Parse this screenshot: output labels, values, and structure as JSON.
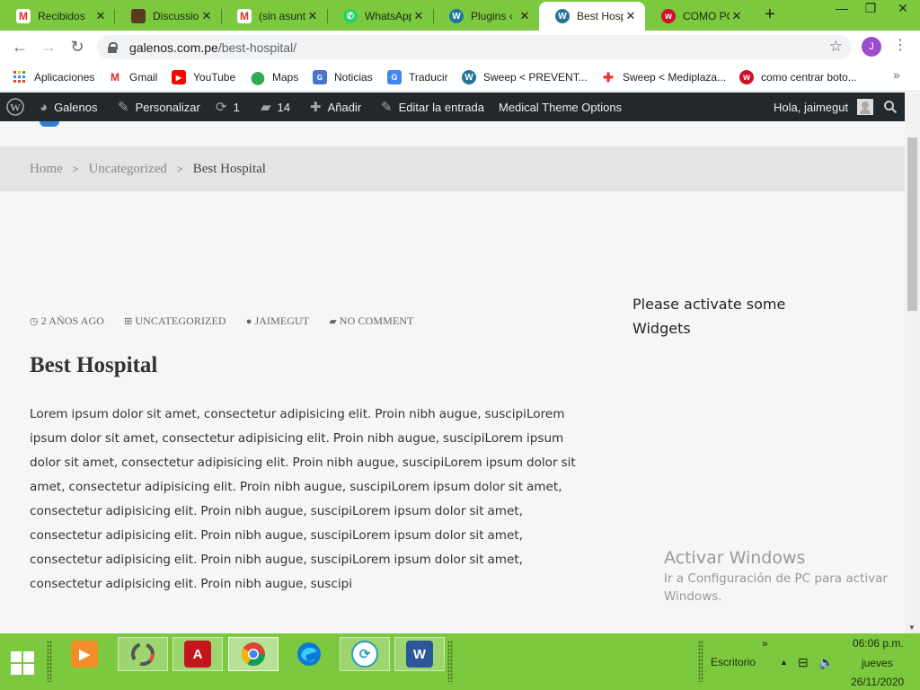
{
  "browser": {
    "tabs": [
      {
        "title": "Recibidos",
        "icon": "gmail-icon",
        "active": false
      },
      {
        "title": "Discussior",
        "icon": "site-thumbnail-icon",
        "active": false
      },
      {
        "title": "(sin asunt",
        "icon": "gmail-icon",
        "active": false
      },
      {
        "title": "WhatsApp",
        "icon": "whatsapp-icon",
        "active": false
      },
      {
        "title": "Plugins ‹",
        "icon": "wordpress-icon",
        "active": false
      },
      {
        "title": "Best Hosp",
        "icon": "wordpress-icon",
        "active": true
      },
      {
        "title": "COMO PC",
        "icon": "w-red-icon",
        "active": false
      }
    ],
    "new_tab": "+",
    "window_controls": {
      "minimize": "—",
      "restore": "❐",
      "close": "✕"
    },
    "url_host": "galenos.com.pe",
    "url_path": "/best-hospital/",
    "profile_initial": "J",
    "bookmarks": [
      {
        "label": "Aplicaciones",
        "icon": "apps-grid-icon"
      },
      {
        "label": "Gmail",
        "icon": "gmail-icon"
      },
      {
        "label": "YouTube",
        "icon": "youtube-icon"
      },
      {
        "label": "Maps",
        "icon": "maps-pin-icon"
      },
      {
        "label": "Noticias",
        "icon": "news-icon"
      },
      {
        "label": "Traducir",
        "icon": "translate-icon"
      },
      {
        "label": "Sweep < PREVENT...",
        "icon": "wordpress-icon"
      },
      {
        "label": "Sweep < Mediplaza...",
        "icon": "mediplaza-icon"
      },
      {
        "label": "como centrar boto...",
        "icon": "w-red-icon"
      }
    ],
    "bookmarks_more": "»"
  },
  "adminbar": {
    "site_name": "Galenos",
    "customize": "Personalizar",
    "updates_count": "1",
    "comments_count": "14",
    "add_new": "Añadir",
    "edit_post": "Editar la entrada",
    "theme_options": "Medical Theme Options",
    "greeting": "Hola, jaimegut"
  },
  "breadcrumb": {
    "home": "Home",
    "category": "Uncategorized",
    "current": "Best Hospital",
    "separator": ">"
  },
  "post": {
    "date": "2 AÑOS AGO",
    "category": "UNCATEGORIZED",
    "author": "JAIMEGUT",
    "comments": "NO COMMENT",
    "title": "Best Hospital",
    "body": "Lorem ipsum dolor sit amet, consectetur adipisicing elit. Proin nibh augue, suscipiLorem ipsum dolor sit amet, consectetur adipisicing elit. Proin nibh augue, suscipiLorem ipsum dolor sit amet, consectetur adipisicing elit. Proin nibh augue, suscipiLorem ipsum dolor sit amet, consectetur adipisicing elit. Proin nibh augue, suscipiLorem ipsum dolor sit amet, consectetur adipisicing elit. Proin nibh augue, suscipiLorem ipsum dolor sit amet, consectetur adipisicing elit. Proin nibh augue, suscipiLorem ipsum dolor sit amet, consectetur adipisicing elit. Proin nibh augue, suscipiLorem ipsum dolor sit amet, consectetur adipisicing elit. Proin nibh augue, suscipi"
  },
  "sidebar": {
    "widget_message": "Please activate some Widgets"
  },
  "windows_watermark": {
    "title": "Activar Windows",
    "subtitle": "Ir a Configuración de PC para activar Windows."
  },
  "taskbar": {
    "apps": [
      {
        "name": "media-player-icon"
      },
      {
        "name": "loading-app-icon"
      },
      {
        "name": "acrobat-icon"
      },
      {
        "name": "chrome-icon"
      },
      {
        "name": "edge-icon"
      },
      {
        "name": "sync-app-icon"
      },
      {
        "name": "word-icon"
      }
    ],
    "desktop_label": "Escritorio",
    "chevron": "»",
    "time": "06:06 p.m.",
    "day": "jueves",
    "date": "26/11/2020"
  },
  "colors": {
    "theme_green": "#7cc83f",
    "wp_adminbar": "#23282d",
    "breadcrumb_bg": "#e4e4e4",
    "page_bg": "#f6f6f6"
  }
}
